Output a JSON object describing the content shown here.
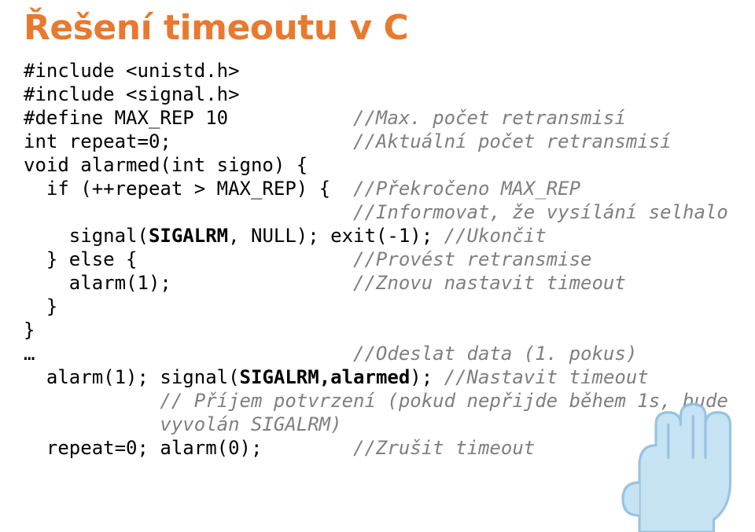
{
  "title": "Řešení timeoutu v C",
  "code": {
    "l1a": "#include <unistd.h>",
    "l2a": "#include <signal.h>",
    "l3a": "#define MAX_REP 10           ",
    "l3c": "//Max. počet retransmisí",
    "l4a": "int repeat=0;                ",
    "l4c": "//Aktuální počet retransmisí",
    "l5a": "void alarmed(int signo) {",
    "l6a": "  if (++repeat > MAX_REP) {  ",
    "l6c": "//Překročeno MAX_REP",
    "l7c": "                             //Informovat, že vysílání selhalo",
    "l8a": "    signal(",
    "l8b": "SIGALRM",
    "l8d": ", NULL); exit(-1); ",
    "l8c": "//Ukončit",
    "l9a": "  } else {                   ",
    "l9c": "//Provést retransmise",
    "l10a": "    alarm(1);                ",
    "l10c": "//Znovu nastavit timeout",
    "l11a": "  }",
    "l12a": "}",
    "l13a": "…                            ",
    "l13c": "//Odeslat data (1. pokus)",
    "l14a": "  alarm(1); signal(",
    "l14b": "SIGALRM,alarmed",
    "l14d": "); ",
    "l14c": "//Nastavit timeout",
    "l15c": "            // Příjem potvrzení (pokud nepřijde během 1s, bude\n            vyvolán SIGALRM)",
    "l16a": "  repeat=0; alarm(0);        ",
    "l16c": "//Zrušit timeout"
  }
}
